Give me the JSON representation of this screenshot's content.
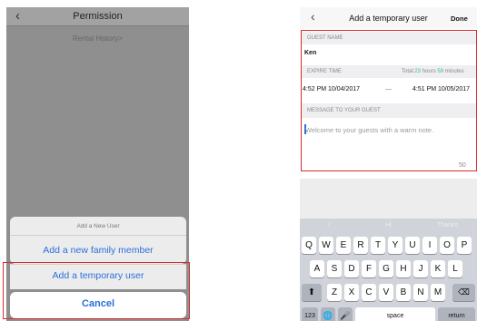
{
  "left_phone": {
    "nav": {
      "back_icon": "chevron-left",
      "title": "Permission"
    },
    "rental_history_link": "Rental History>",
    "action_sheet": {
      "title": "Add a New User",
      "items": [
        "Add a new family member",
        "Add a temporary user"
      ],
      "cancel": "Cancel"
    }
  },
  "right_phone": {
    "nav": {
      "back_icon": "chevron-left",
      "title": "Add a temporary user",
      "done": "Done"
    },
    "guest_name": {
      "label": "GUEST NAME",
      "value": "Ken"
    },
    "expire_time": {
      "label": "EXPIRE TIME",
      "total_prefix": "Total:",
      "total_hours": "23",
      "hours_word": "hours",
      "total_minutes": "59",
      "minutes_word": "minutes",
      "start": "4:52 PM 10/04/2017",
      "separator": "—",
      "end": "4:51 PM 10/05/2017"
    },
    "message": {
      "label": "MESSAGE TO YOUR GUEST",
      "placeholder": "Welcome to your guests with a warm note.",
      "counter": "50"
    },
    "keyboard": {
      "suggestions": [
        "I",
        "Hi",
        "Thanks"
      ],
      "row1": [
        "Q",
        "W",
        "E",
        "R",
        "T",
        "Y",
        "U",
        "I",
        "O",
        "P"
      ],
      "row2": [
        "A",
        "S",
        "D",
        "F",
        "G",
        "H",
        "J",
        "K",
        "L"
      ],
      "row3": [
        "Z",
        "X",
        "C",
        "V",
        "B",
        "N",
        "M"
      ],
      "numbers_key": "123",
      "space_key": "space",
      "return_key": "return",
      "shift_icon": "shift-arrow",
      "delete_icon": "delete-key",
      "globe_icon": "globe",
      "mic_icon": "microphone"
    }
  },
  "colors": {
    "highlight": "#d62b2b",
    "accent": "#2b6fdc",
    "total_accent": "#3bb3a0"
  }
}
